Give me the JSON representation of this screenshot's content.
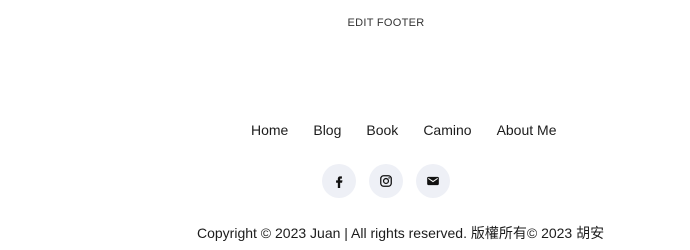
{
  "footer": {
    "edit_label": "EDIT FOOTER",
    "nav": [
      {
        "label": "Home"
      },
      {
        "label": "Blog"
      },
      {
        "label": "Book"
      },
      {
        "label": "Camino"
      },
      {
        "label": "About Me"
      }
    ],
    "social": [
      {
        "icon": "facebook-icon"
      },
      {
        "icon": "instagram-icon"
      },
      {
        "icon": "email-icon"
      }
    ],
    "copyright": "Copyright © 2023 Juan | All rights reserved. 版權所有© 2023 胡安"
  },
  "colors": {
    "text": "#1c1c1c",
    "social_bg": "#eef0f6",
    "icon": "#111111"
  }
}
